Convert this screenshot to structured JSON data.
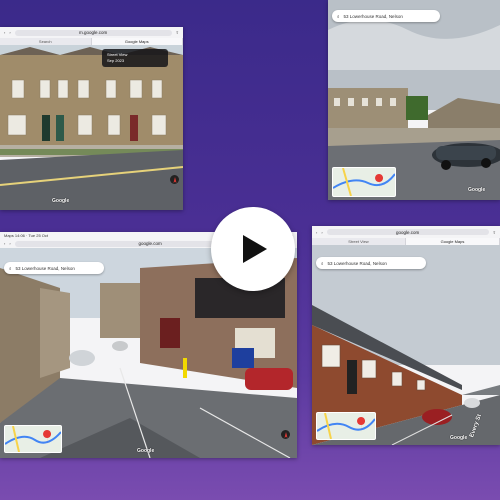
{
  "frames": [
    {
      "url": "m.google.com",
      "tab_left": "Search",
      "tab_right": "Google Maps",
      "info_line1": "Street View",
      "info_line2": "Sep 2023",
      "google": "Google"
    },
    {
      "search": "53 Lowerhouse Road, Nelson",
      "google": "Google"
    },
    {
      "status_left": "Maps 14:06 · Tue 25 Oct",
      "status_right": "70%",
      "url": "google.com",
      "search": "53 Lowerhouse Road, Nelson",
      "google": "Google"
    },
    {
      "url": "google.com",
      "tab_left": "Street View",
      "tab_right": "Google Maps",
      "search": "53 Lowerhouse Road, Nelson",
      "road_label": "Every St",
      "google": "Google"
    }
  ],
  "colors": {
    "bg_top": "#3b2a8a",
    "bg_bottom": "#7a4cb0",
    "pin": "#e53935",
    "route": "#4285f4"
  },
  "icons": [
    "play-icon",
    "search-icon",
    "pin-icon",
    "compass-icon",
    "back-icon",
    "forward-icon",
    "share-icon"
  ]
}
